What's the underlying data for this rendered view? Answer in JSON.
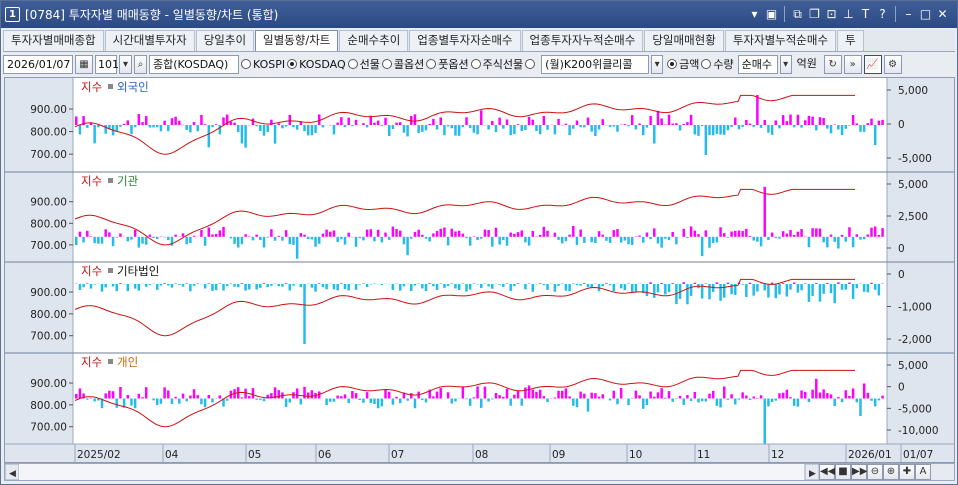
{
  "window": {
    "number": "1",
    "title": "[0784] 투자자별 매매동향 - 일별동향/차트 (통합)",
    "icons": [
      "dropdown-arrow-icon",
      "memo-icon",
      "link-icon",
      "window-icon",
      "restore-icon",
      "pin-icon",
      "font-icon",
      "help-icon",
      "minimize-icon",
      "maximize-icon",
      "close-icon"
    ]
  },
  "tabs": [
    {
      "label": "투자자별매매종합",
      "active": false
    },
    {
      "label": "시간대별투자자",
      "active": false
    },
    {
      "label": "당일추이",
      "active": false
    },
    {
      "label": "일별동향/차트",
      "active": true
    },
    {
      "label": "순매수추이",
      "active": false
    },
    {
      "label": "업종별투자자순매수",
      "active": false
    },
    {
      "label": "업종투자자누적순매수",
      "active": false
    },
    {
      "label": "당일매매현황",
      "active": false
    },
    {
      "label": "투자자별누적순매수",
      "active": false
    },
    {
      "label": "투",
      "active": false
    }
  ],
  "toolbar": {
    "date": "2026/01/07",
    "code": "101",
    "market": "종합(KOSDAQ)",
    "radios": [
      {
        "label": "KOSPI",
        "on": false
      },
      {
        "label": "KOSDAQ",
        "on": true
      },
      {
        "label": "선물",
        "on": false
      },
      {
        "label": "콜옵션",
        "on": false
      },
      {
        "label": "풋옵션",
        "on": false
      },
      {
        "label": "주식선물",
        "on": false
      },
      {
        "label": "",
        "on": false
      }
    ],
    "product": "(월)K200위클리콜",
    "unit_radios": [
      {
        "label": "금액",
        "on": true
      },
      {
        "label": "수량",
        "on": false
      }
    ],
    "trade_type": "순매수",
    "unit": "억원"
  },
  "panels": [
    {
      "index_label": "지수",
      "investor_label": "외국인",
      "investor_color": "#2b5fb3",
      "right_ticks": [
        "5,000",
        "0",
        "-5,000"
      ]
    },
    {
      "index_label": "지수",
      "investor_label": "기관",
      "investor_color": "#2e7d32",
      "right_ticks": [
        "5,000",
        "2,500",
        "0"
      ]
    },
    {
      "index_label": "지수",
      "investor_label": "기타법인",
      "investor_color": "#111111",
      "right_ticks": [
        "0",
        "-1,000",
        "-2,000"
      ]
    },
    {
      "index_label": "지수",
      "investor_label": "개인",
      "investor_color": "#d06a00",
      "right_ticks": [
        "5,000",
        "0",
        "-5,000",
        "-10,000"
      ]
    }
  ],
  "left_ticks": [
    "900.00",
    "800.00",
    "700.00"
  ],
  "date_ticks": [
    "2025/02",
    "04",
    "05",
    "06",
    "07",
    "08",
    "09",
    "10",
    "11",
    "12",
    "2026/01",
    "01/07"
  ],
  "colors": {
    "index_line": "#cc1111",
    "positive_bar": "#ff00ff",
    "negative_bar": "#22bbee",
    "title_bar": "#2f4f8a"
  }
}
